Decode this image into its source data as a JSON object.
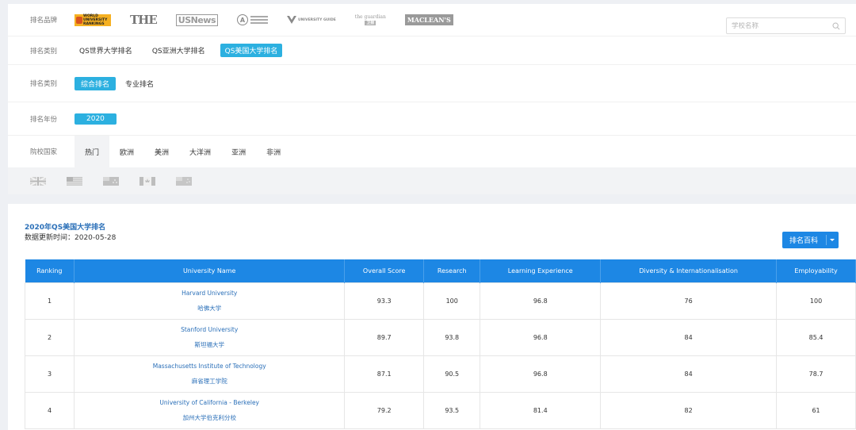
{
  "filters": {
    "brand": {
      "label": "排名品牌",
      "logos": [
        {
          "name": "qs",
          "text_top": "WORLD",
          "text_mid": "UNIVERSITY",
          "text_bottom": "RANKINGS"
        },
        {
          "name": "the",
          "text": "THE"
        },
        {
          "name": "usnews",
          "text": "USNews"
        },
        {
          "name": "arwu",
          "text": "A"
        },
        {
          "name": "complete-university-guide",
          "text": "UNIVERSITY GUIDE"
        },
        {
          "name": "guardian",
          "text": "the guardian",
          "sub": "卫报"
        },
        {
          "name": "macleans",
          "text": "MACLEAN'S"
        }
      ],
      "search_placeholder": "学校名称"
    },
    "category": {
      "label": "排名类别",
      "options": [
        "QS世界大学排名",
        "QS亚洲大学排名",
        "QS美国大学排名"
      ],
      "selected": "QS美国大学排名"
    },
    "type": {
      "label": "排名类别",
      "options": [
        "综合排名",
        "专业排名"
      ],
      "selected": "综合排名"
    },
    "year": {
      "label": "排名年份",
      "options": [
        "2020"
      ],
      "selected": "2020"
    },
    "country": {
      "label": "院校国家",
      "options": [
        "热门",
        "欧洲",
        "美洲",
        "大洋洲",
        "亚洲",
        "非洲"
      ],
      "selected": "热门",
      "flags": [
        "uk-flag-icon",
        "us-flag-icon",
        "au-flag-icon",
        "ca-flag-icon",
        "nz-flag-icon"
      ]
    }
  },
  "ranking": {
    "title": "2020年QS美国大学排名",
    "updated": "数据更新时间：2020-05-28",
    "wiki_button": "排名百科",
    "columns": [
      "Ranking",
      "University Name",
      "Overall Score",
      "Research",
      "Learning Experience",
      "Diversity & Internationalisation",
      "Employability"
    ],
    "rows": [
      {
        "rank": "1",
        "name_en": "Harvard University",
        "name_cn": "哈佛大学",
        "overall": "93.3",
        "research": "100",
        "learning": "96.8",
        "diversity": "76",
        "employability": "100"
      },
      {
        "rank": "2",
        "name_en": "Stanford University",
        "name_cn": "斯坦福大学",
        "overall": "89.7",
        "research": "93.8",
        "learning": "96.8",
        "diversity": "84",
        "employability": "85.4"
      },
      {
        "rank": "3",
        "name_en": "Massachusetts Institute of Technology",
        "name_cn": "麻省理工学院",
        "overall": "87.1",
        "research": "90.5",
        "learning": "96.8",
        "diversity": "84",
        "employability": "78.7"
      },
      {
        "rank": "4",
        "name_en": "University of California - Berkeley",
        "name_cn": "加州大学伯克利分校",
        "overall": "79.2",
        "research": "93.5",
        "learning": "81.4",
        "diversity": "82",
        "employability": "61"
      }
    ]
  },
  "colors": {
    "accent": "#2cb0e0",
    "header_blue": "#1d87e4",
    "link_blue": "#2a6fb8"
  }
}
